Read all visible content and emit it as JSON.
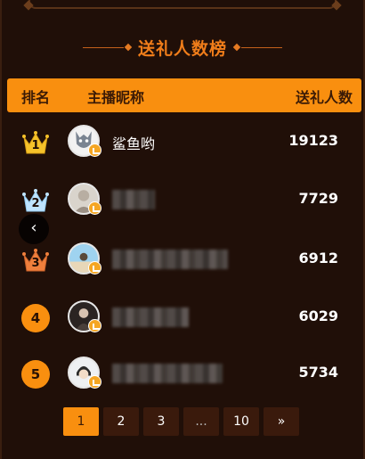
{
  "title": "送礼人数榜",
  "header": {
    "rank_label": "排名",
    "name_label": "主播昵称",
    "count_label": "送礼人数"
  },
  "rows": [
    {
      "rank": "1",
      "rank_style": "gold-crown",
      "name": "鲨鱼哟",
      "name_blurred": false,
      "count": "19123"
    },
    {
      "rank": "2",
      "rank_style": "silver-crown",
      "name": "",
      "name_blurred": true,
      "count": "7729"
    },
    {
      "rank": "3",
      "rank_style": "bronze-crown",
      "name": "",
      "name_blurred": true,
      "count": "6912"
    },
    {
      "rank": "4",
      "rank_style": "orange-circle",
      "name": "",
      "name_blurred": true,
      "count": "6029"
    },
    {
      "rank": "5",
      "rank_style": "orange-circle",
      "name": "",
      "name_blurred": true,
      "count": "5734"
    }
  ],
  "back_button": {
    "icon": "chevron-left-icon",
    "glyph": "‹"
  },
  "pagination": {
    "pages": [
      "1",
      "2",
      "3",
      "...",
      "10"
    ],
    "current": "1",
    "next_label": "»"
  },
  "colors": {
    "accent": "#f98f0f",
    "background": "#200f08",
    "title": "#f07d1a",
    "gold": "#f5c22a",
    "silver": "#bfe4ff",
    "bronze": "#ef7f3c"
  }
}
